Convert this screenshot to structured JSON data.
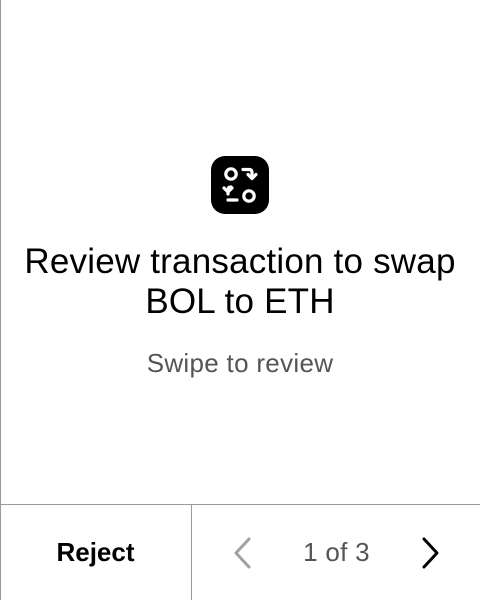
{
  "screen": {
    "icon": "swap-arrows-icon",
    "title": "Review transaction to swap BOL to ETH",
    "subtitle": "Swipe to review"
  },
  "footer": {
    "reject_label": "Reject",
    "prev_icon": "chevron-left-icon",
    "next_icon": "chevron-right-icon",
    "page_indicator": "1 of 3",
    "prev_enabled": false,
    "next_enabled": true
  },
  "colors": {
    "background": "#ffffff",
    "text": "#000000",
    "secondary_text": "#555555",
    "disabled_icon": "#a0a0a0",
    "divider": "#9a9a9a"
  }
}
